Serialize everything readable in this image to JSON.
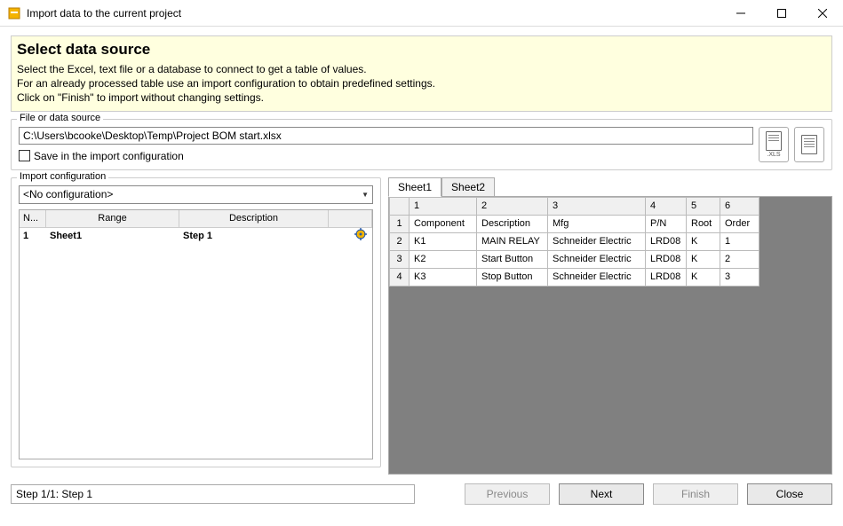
{
  "window": {
    "title": "Import data to the current project"
  },
  "header": {
    "title": "Select data source",
    "line1": "Select the Excel, text file or a database to connect to get a table of values.",
    "line2": "For an already processed table use an import configuration to obtain predefined settings.",
    "line3": "Click on \"Finish\" to import without changing settings."
  },
  "fileGroup": {
    "label": "File or data source",
    "path": "C:\\Users\\bcooke\\Desktop\\Temp\\Project BOM start.xlsx",
    "saveLabel": "Save in the import configuration",
    "xlsLabel": ".XLS"
  },
  "configGroup": {
    "label": "Import configuration",
    "selected": "<No configuration>",
    "columns": {
      "n": "N...",
      "range": "Range",
      "desc": "Description"
    },
    "row": {
      "n": "1",
      "range": "Sheet1",
      "desc": "Step 1"
    }
  },
  "sheetTabs": [
    "Sheet1",
    "Sheet2"
  ],
  "sheet": {
    "colHeaders": [
      "1",
      "2",
      "3",
      "4",
      "5",
      "6"
    ],
    "rows": [
      {
        "h": "1",
        "cells": [
          "Component",
          "Description",
          "Mfg",
          "P/N",
          "Root",
          "Order"
        ]
      },
      {
        "h": "2",
        "cells": [
          "K1",
          "MAIN RELAY",
          "Schneider Electric",
          "LRD08",
          "K",
          "1"
        ]
      },
      {
        "h": "3",
        "cells": [
          "K2",
          "Start Button",
          "Schneider Electric",
          "LRD08",
          "K",
          "2"
        ]
      },
      {
        "h": "4",
        "cells": [
          "K3",
          "Stop Button",
          "Schneider Electric",
          "LRD08",
          "K",
          "3"
        ]
      }
    ]
  },
  "status": "Step 1/1: Step 1",
  "buttons": {
    "prev": "Previous",
    "next": "Next",
    "finish": "Finish",
    "close": "Close"
  }
}
